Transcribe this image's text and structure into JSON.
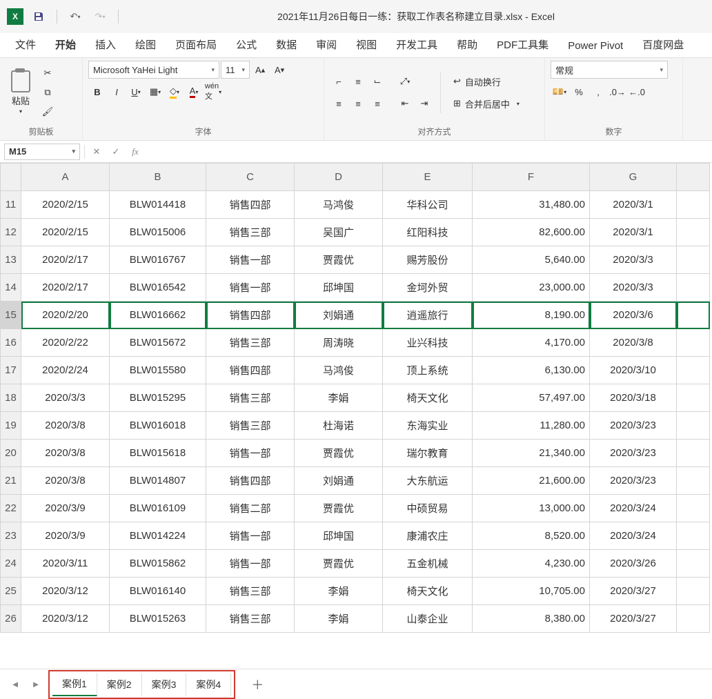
{
  "title": "2021年11月26日每日一练：获取工作表名称建立目录.xlsx  -  Excel",
  "tabs": [
    "文件",
    "开始",
    "插入",
    "绘图",
    "页面布局",
    "公式",
    "数据",
    "审阅",
    "视图",
    "开发工具",
    "帮助",
    "PDF工具集",
    "Power Pivot",
    "百度网盘"
  ],
  "activeTab": 1,
  "font": {
    "name": "Microsoft YaHei Light",
    "size": "11"
  },
  "numFormat": "常规",
  "wrapText": "自动换行",
  "mergeCenter": "合并后居中",
  "groups": {
    "clipboard": "剪贴板",
    "font": "字体",
    "align": "对齐方式",
    "number": "数字",
    "paste": "粘贴"
  },
  "nameBox": "M15",
  "formula": "",
  "columns": [
    "A",
    "B",
    "C",
    "D",
    "E",
    "F",
    "G"
  ],
  "rowStart": 11,
  "selectedRow": 15,
  "rows": [
    {
      "a": "2020/2/15",
      "b": "BLW014418",
      "c": "销售四部",
      "d": "马鸿俊",
      "e": "华科公司",
      "f": "31,480.00",
      "g": "2020/3/1"
    },
    {
      "a": "2020/2/15",
      "b": "BLW015006",
      "c": "销售三部",
      "d": "吴国广",
      "e": "红阳科技",
      "f": "82,600.00",
      "g": "2020/3/1"
    },
    {
      "a": "2020/2/17",
      "b": "BLW016767",
      "c": "销售一部",
      "d": "贾霞优",
      "e": "赐芳股份",
      "f": "5,640.00",
      "g": "2020/3/3"
    },
    {
      "a": "2020/2/17",
      "b": "BLW016542",
      "c": "销售一部",
      "d": "邱坤国",
      "e": "金坷外贸",
      "f": "23,000.00",
      "g": "2020/3/3"
    },
    {
      "a": "2020/2/20",
      "b": "BLW016662",
      "c": "销售四部",
      "d": "刘娟通",
      "e": "逍遥旅行",
      "f": "8,190.00",
      "g": "2020/3/6"
    },
    {
      "a": "2020/2/22",
      "b": "BLW015672",
      "c": "销售三部",
      "d": "周涛晓",
      "e": "业兴科技",
      "f": "4,170.00",
      "g": "2020/3/8"
    },
    {
      "a": "2020/2/24",
      "b": "BLW015580",
      "c": "销售四部",
      "d": "马鸿俊",
      "e": "顶上系统",
      "f": "6,130.00",
      "g": "2020/3/10"
    },
    {
      "a": "2020/3/3",
      "b": "BLW015295",
      "c": "销售三部",
      "d": "李娟",
      "e": "椅天文化",
      "f": "57,497.00",
      "g": "2020/3/18"
    },
    {
      "a": "2020/3/8",
      "b": "BLW016018",
      "c": "销售三部",
      "d": "杜海诺",
      "e": "东海实业",
      "f": "11,280.00",
      "g": "2020/3/23"
    },
    {
      "a": "2020/3/8",
      "b": "BLW015618",
      "c": "销售一部",
      "d": "贾霞优",
      "e": "瑞尔教育",
      "f": "21,340.00",
      "g": "2020/3/23"
    },
    {
      "a": "2020/3/8",
      "b": "BLW014807",
      "c": "销售四部",
      "d": "刘娟通",
      "e": "大东航运",
      "f": "21,600.00",
      "g": "2020/3/23"
    },
    {
      "a": "2020/3/9",
      "b": "BLW016109",
      "c": "销售二部",
      "d": "贾霞优",
      "e": "中硕贸易",
      "f": "13,000.00",
      "g": "2020/3/24"
    },
    {
      "a": "2020/3/9",
      "b": "BLW014224",
      "c": "销售一部",
      "d": "邱坤国",
      "e": "康浦农庄",
      "f": "8,520.00",
      "g": "2020/3/24"
    },
    {
      "a": "2020/3/11",
      "b": "BLW015862",
      "c": "销售一部",
      "d": "贾霞优",
      "e": "五金机械",
      "f": "4,230.00",
      "g": "2020/3/26"
    },
    {
      "a": "2020/3/12",
      "b": "BLW016140",
      "c": "销售三部",
      "d": "李娟",
      "e": "椅天文化",
      "f": "10,705.00",
      "g": "2020/3/27"
    },
    {
      "a": "2020/3/12",
      "b": "BLW015263",
      "c": "销售三部",
      "d": "李娟",
      "e": "山泰企业",
      "f": "8,380.00",
      "g": "2020/3/27"
    }
  ],
  "sheets": [
    "案例1",
    "案例2",
    "案例3",
    "案例4"
  ],
  "activeSheet": 0
}
